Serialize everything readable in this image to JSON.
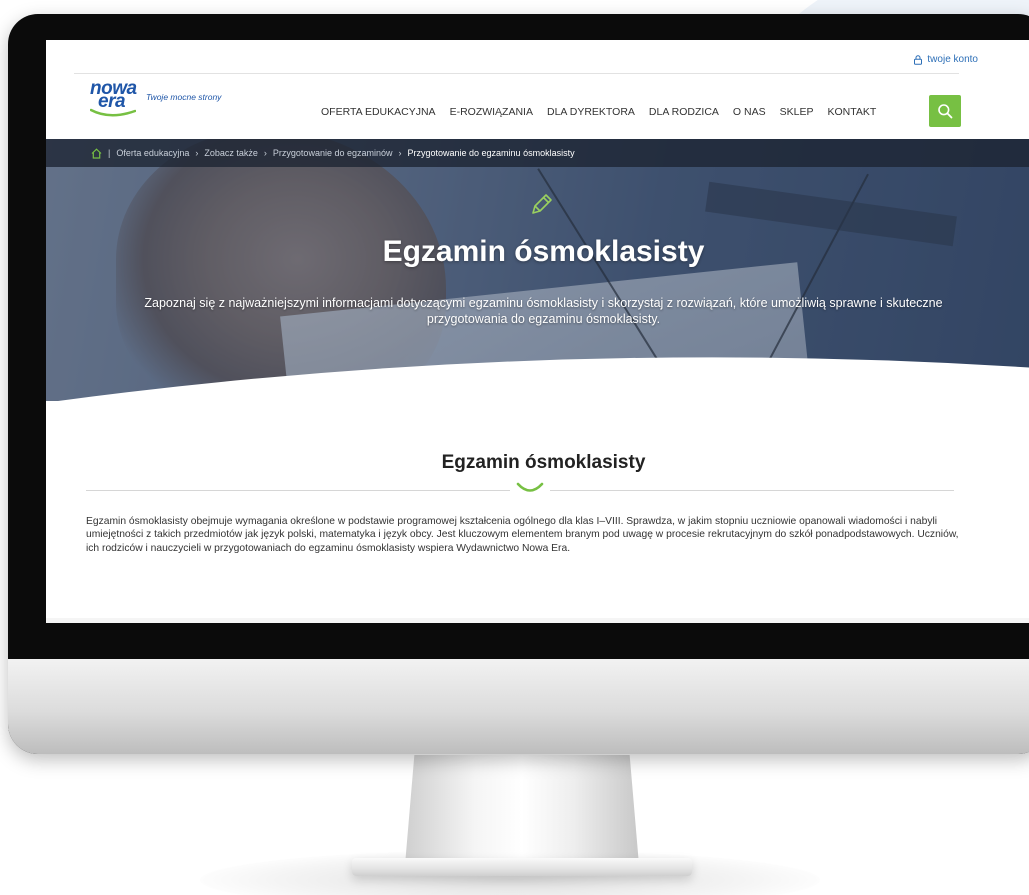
{
  "header": {
    "account_label": "twoje konto",
    "logo_word_1": "nowa",
    "logo_word_2": "era",
    "logo_tagline": "Twoje mocne strony",
    "nav": [
      "OFERTA EDUKACYJNA",
      "E-ROZWIĄZANIA",
      "DLA DYREKTORA",
      "DLA RODZICA",
      "O NAS",
      "SKLEP",
      "KONTAKT"
    ],
    "search_icon": "search-icon"
  },
  "breadcrumb": {
    "items": [
      "Oferta edukacyjna",
      "Zobacz także",
      "Przygotowanie do egzaminów",
      "Przygotowanie do egzaminu ósmoklasisty"
    ]
  },
  "hero": {
    "title": "Egzamin ósmoklasisty",
    "text": "Zapoznaj się z najważniejszymi informacjami dotyczącymi egzaminu ósmoklasisty i skorzystaj z rozwiązań, które umożliwią sprawne i skuteczne przygotowania do egzaminu ósmoklasisty."
  },
  "section": {
    "title": "Egzamin ósmoklasisty",
    "body": "Egzamin ósmoklasisty obejmuje wymagania określone w podstawie programowej kształcenia ogólnego dla klas I–VIII. Sprawdza, w jakim stopniu uczniowie opanowali wiadomości i nabyli umiejętności z takich przedmiotów jak język polski, matematyka i język obcy. Jest kluczowym elementem branym pod uwagę w procesie rekrutacyjnym do szkół ponadpodstawowych. Uczniów, ich rodziców i nauczycieli w przygotowaniach do egzaminu ósmoklasisty wspiera Wydawnictwo Nowa Era."
  },
  "colors": {
    "brand_blue": "#1f56a8",
    "accent_green": "#77c043",
    "text": "#333333"
  }
}
